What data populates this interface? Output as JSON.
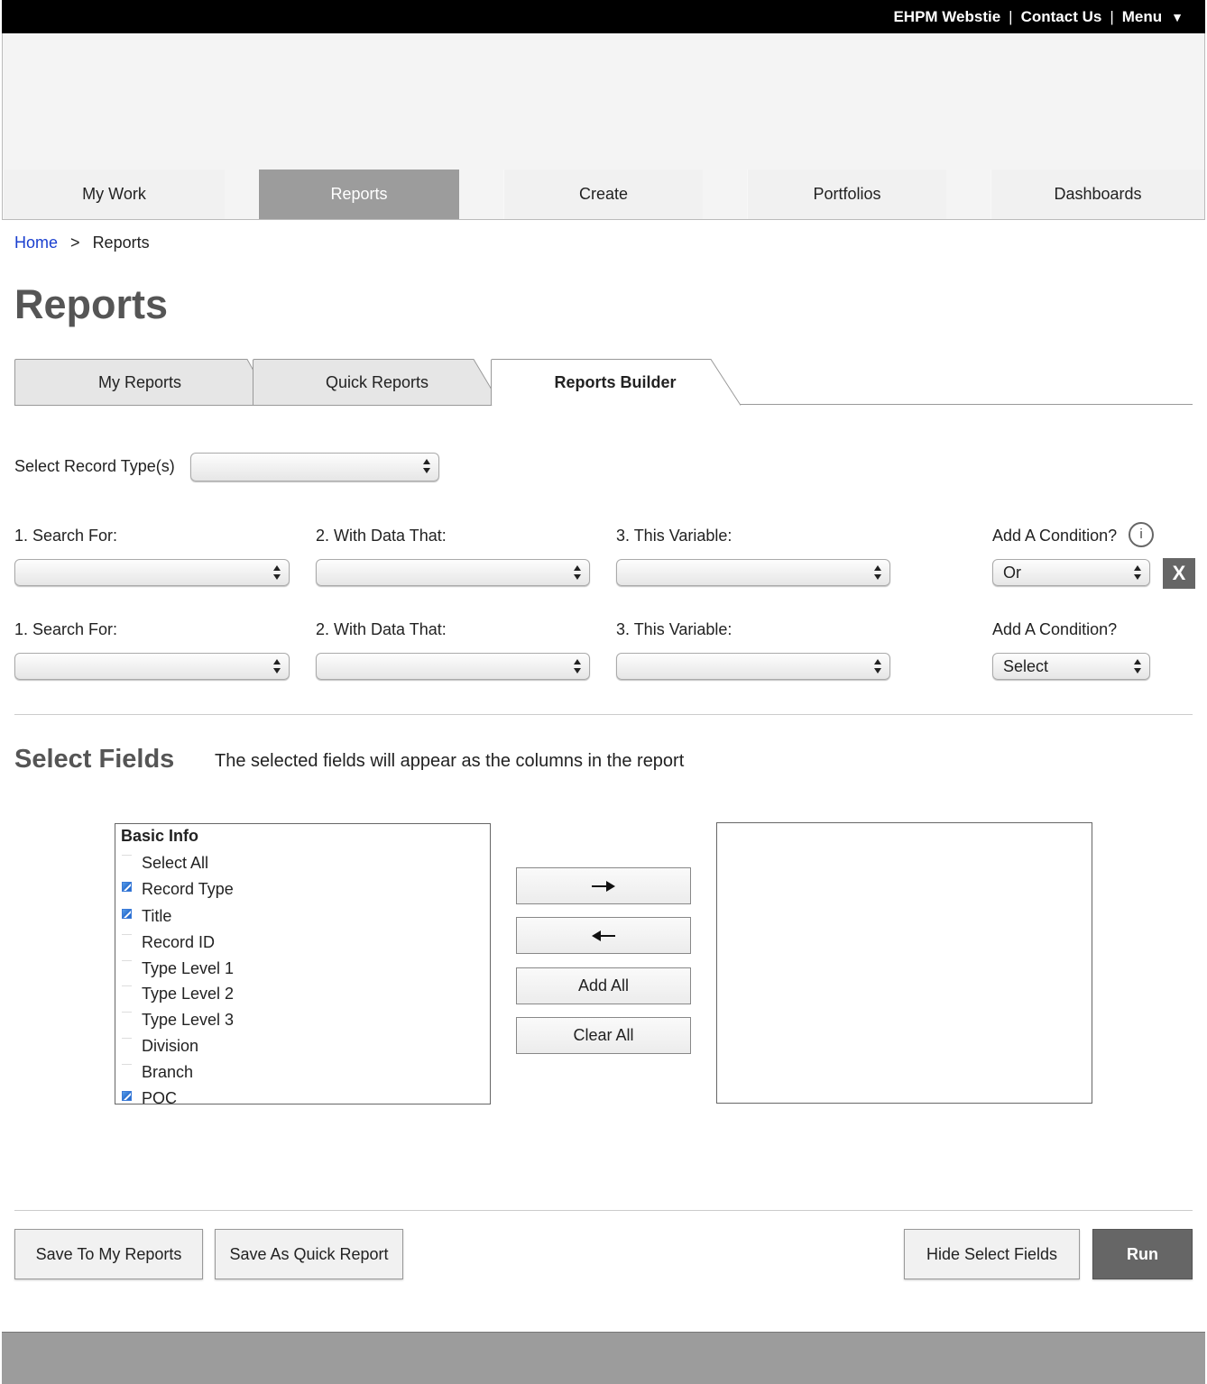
{
  "topbar": {
    "link1": "EHPM Webstie",
    "link2": "Contact Us",
    "menu": "Menu",
    "sep": "|",
    "menu_arrow": "▼"
  },
  "nav": [
    {
      "label": "My Work"
    },
    {
      "label": "Reports",
      "active": true
    },
    {
      "label": "Create"
    },
    {
      "label": "Portfolios"
    },
    {
      "label": "Dashboards"
    }
  ],
  "breadcrumb": {
    "home": "Home",
    "sep": ">",
    "current": "Reports"
  },
  "page_title": "Reports",
  "tabs": [
    {
      "label": "My Reports"
    },
    {
      "label": "Quick Reports"
    },
    {
      "label": "Reports Builder",
      "active": true
    }
  ],
  "record_type": {
    "label": "Select Record Type(s)",
    "value": ""
  },
  "condition_rows": [
    {
      "search_for_label": "1. Search For:",
      "with_data_label": "2. With Data That:",
      "variable_label": "3. This Variable:",
      "add_condition_label": "Add A Condition?",
      "condition_value": "Or"
    },
    {
      "search_for_label": "1. Search For:",
      "with_data_label": "2. With Data That:",
      "variable_label": "3. This Variable:",
      "add_condition_label": "Add A Condition?",
      "condition_value": "Select"
    }
  ],
  "info_glyph": "i",
  "remove_glyph": "X",
  "select_fields": {
    "title": "Select Fields",
    "description": "The selected fields will appear as the columns in the report",
    "group": "Basic Info",
    "items": [
      {
        "label": "Select All",
        "checked": false
      },
      {
        "label": "Record Type",
        "checked": true
      },
      {
        "label": "Title",
        "checked": true
      },
      {
        "label": "Record ID",
        "checked": false
      },
      {
        "label": "Type Level 1",
        "checked": false
      },
      {
        "label": "Type Level 2",
        "checked": false
      },
      {
        "label": "Type Level 3",
        "checked": false
      },
      {
        "label": "Division",
        "checked": false
      },
      {
        "label": "Branch",
        "checked": false
      },
      {
        "label": "POC",
        "checked": true
      }
    ],
    "add_all": "Add All",
    "clear_all": "Clear All"
  },
  "actions": {
    "save_my_reports": "Save To My Reports",
    "save_quick": "Save As Quick Report",
    "hide_fields": "Hide Select Fields",
    "run": "Run"
  },
  "icons": {
    "move_right": "arrow-right-icon",
    "move_left": "arrow-left-icon",
    "select_arrows": "up-down-arrows-icon"
  }
}
